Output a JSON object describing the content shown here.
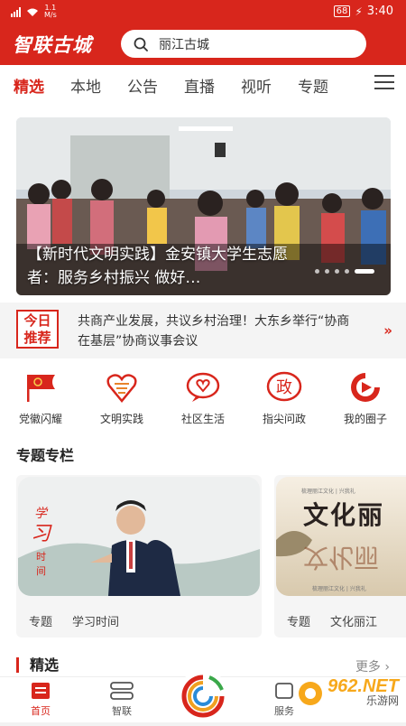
{
  "status_bar": {
    "network_speed": "1.1",
    "speed_unit": "M/s",
    "battery": "68",
    "time": "3:40"
  },
  "header": {
    "app_title": "智联古城",
    "search_value": "丽江古城"
  },
  "tabs": [
    "精选",
    "本地",
    "公告",
    "直播",
    "视听",
    "专题"
  ],
  "banner": {
    "title": "【新时代文明实践】金安镇大学生志愿者：服务乡村振兴 做好…"
  },
  "recommend": {
    "badge_line1": "今日",
    "badge_line2": "推荐",
    "text": "共商产业发展，共议乡村治理！大东乡举行“协商在基层”协商议事会议",
    "arrow": "»"
  },
  "quick_icons": [
    {
      "label": "党徽闪耀",
      "icon": "party-flag-icon"
    },
    {
      "label": "文明实践",
      "icon": "civilization-heart-icon"
    },
    {
      "label": "社区生活",
      "icon": "community-heart-icon"
    },
    {
      "label": "指尖问政",
      "icon": "politics-zheng-icon",
      "glyph": "政"
    },
    {
      "label": "我的圈子",
      "icon": "circle-play-icon"
    }
  ],
  "special_section": {
    "title": "专题专栏"
  },
  "cards": [
    {
      "tag": "专题",
      "name": "学习时间",
      "img_text": "学习时间"
    },
    {
      "tag": "专题",
      "name": "文化丽江",
      "img_text": "文化丽江"
    }
  ],
  "featured": {
    "title": "精选",
    "more": "更多"
  },
  "bottom_nav": [
    {
      "label": "首页",
      "icon": "home-icon"
    },
    {
      "label": "智联",
      "icon": "zhilian-icon"
    },
    {
      "label": "",
      "icon": "center-logo-icon"
    },
    {
      "label": "服务",
      "icon": "service-icon"
    }
  ],
  "watermark": {
    "text": "962.NET",
    "sub": "乐游网"
  },
  "colors": {
    "brand_red": "#d8261c",
    "text_dark": "#222222",
    "text_gray": "#888888"
  }
}
